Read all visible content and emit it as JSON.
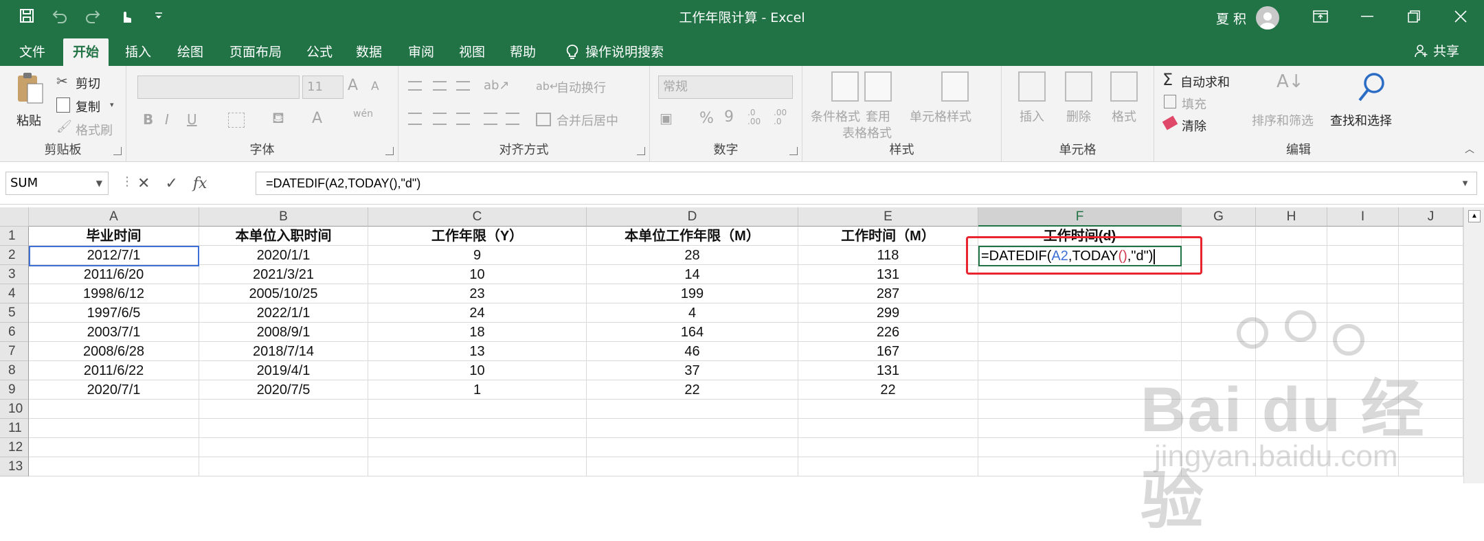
{
  "window": {
    "title": "工作年限计算 - Excel",
    "user_name": "夏 积",
    "share_label": "共享"
  },
  "tabs": [
    "文件",
    "开始",
    "插入",
    "绘图",
    "页面布局",
    "公式",
    "数据",
    "审阅",
    "视图",
    "帮助"
  ],
  "active_tab": "开始",
  "tell_me": "操作说明搜索",
  "ribbon": {
    "clipboard": {
      "paste": "粘贴",
      "cut": "剪切",
      "copy": "复制",
      "format_painter": "格式刷",
      "label": "剪贴板"
    },
    "font": {
      "label": "字体",
      "size": "11",
      "bold": "B",
      "italic": "I",
      "underline": "U"
    },
    "alignment": {
      "label": "对齐方式",
      "wrap": "自动换行",
      "merge": "合并后居中"
    },
    "number": {
      "label": "数字",
      "format": "常规",
      "percent": "%",
      "comma": "9"
    },
    "styles": {
      "label": "样式",
      "conditional": "条件格式",
      "table_1": "套用",
      "table_2": "表格格式",
      "cell_styles": "单元格样式"
    },
    "cells": {
      "label": "单元格",
      "insert": "插入",
      "delete": "删除",
      "format": "格式"
    },
    "editing": {
      "label": "编辑",
      "autosum": "自动求和",
      "fill": "填充",
      "clear": "清除",
      "sort_filter": "排序和筛选",
      "find_select": "查找和选择"
    }
  },
  "formula_bar": {
    "name_box": "SUM",
    "formula": "=DATEDIF(A2,TODAY(),\"d\")"
  },
  "columns": [
    "A",
    "B",
    "C",
    "D",
    "E",
    "F",
    "G",
    "H",
    "I",
    "J"
  ],
  "selected_column": "F",
  "row_numbers": [
    "1",
    "2",
    "3",
    "4",
    "5",
    "6",
    "7",
    "8",
    "9",
    "10",
    "11",
    "12",
    "13"
  ],
  "headers": [
    "毕业时间",
    "本单位入职时间",
    "工作年限（Y）",
    "本单位工作年限（M）",
    "工作时间（M）",
    "工作时间(d)"
  ],
  "rows": [
    [
      "2012/7/1",
      "2020/1/1",
      "9",
      "28",
      "118"
    ],
    [
      "2011/6/20",
      "2021/3/21",
      "10",
      "14",
      "131"
    ],
    [
      "1998/6/12",
      "2005/10/25",
      "23",
      "199",
      "287"
    ],
    [
      "1997/6/5",
      "2022/1/1",
      "24",
      "4",
      "299"
    ],
    [
      "2003/7/1",
      "2008/9/1",
      "18",
      "164",
      "226"
    ],
    [
      "2008/6/28",
      "2018/7/14",
      "13",
      "46",
      "167"
    ],
    [
      "2011/6/22",
      "2019/4/1",
      "10",
      "37",
      "131"
    ],
    [
      "2020/7/1",
      "2020/7/5",
      "1",
      "22",
      "22"
    ]
  ],
  "edit_cell": {
    "part1": "=DATEDIF(",
    "ref": "A2",
    "part2": ",TODAY",
    "paren": "()",
    "part3": ",\"d\")"
  },
  "watermark": {
    "brand": "Bai  du 经验",
    "url": "jingyan.baidu.com"
  }
}
